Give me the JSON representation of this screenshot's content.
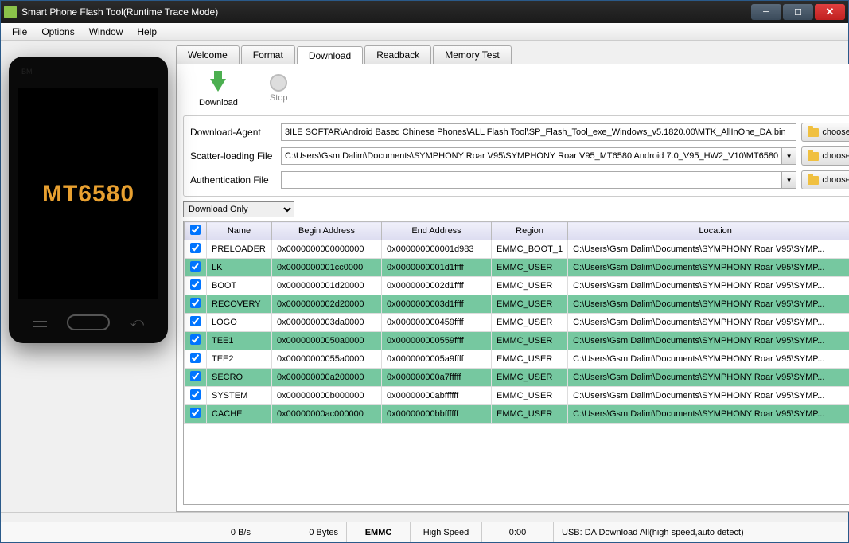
{
  "window": {
    "title": "Smart Phone Flash Tool(Runtime Trace Mode)"
  },
  "menu": [
    "File",
    "Options",
    "Window",
    "Help"
  ],
  "phone": {
    "chip": "MT6580",
    "badge": "BM"
  },
  "tabs": [
    "Welcome",
    "Format",
    "Download",
    "Readback",
    "Memory Test"
  ],
  "activeTab": "Download",
  "toolbar": {
    "download": "Download",
    "stop": "Stop"
  },
  "files": {
    "da_label": "Download-Agent",
    "da_value": "3ILE SOFTAR\\Android Based Chinese Phones\\ALL Flash Tool\\SP_Flash_Tool_exe_Windows_v5.1820.00\\MTK_AllInOne_DA.bin",
    "scatter_label": "Scatter-loading File",
    "scatter_value": "C:\\Users\\Gsm Dalim\\Documents\\SYMPHONY Roar V95\\SYMPHONY Roar V95_MT6580 Android 7.0_V95_HW2_V10\\MT6580",
    "auth_label": "Authentication File",
    "auth_value": "",
    "choose": "choose"
  },
  "mode": "Download Only",
  "table": {
    "headers": {
      "chk": "",
      "name": "Name",
      "begin": "Begin Address",
      "end": "End Address",
      "region": "Region",
      "location": "Location"
    },
    "rows": [
      {
        "alt": false,
        "name": "PRELOADER",
        "begin": "0x0000000000000000",
        "end": "0x000000000001d983",
        "region": "EMMC_BOOT_1",
        "location": "C:\\Users\\Gsm Dalim\\Documents\\SYMPHONY Roar V95\\SYMP..."
      },
      {
        "alt": true,
        "name": "LK",
        "begin": "0x0000000001cc0000",
        "end": "0x0000000001d1ffff",
        "region": "EMMC_USER",
        "location": "C:\\Users\\Gsm Dalim\\Documents\\SYMPHONY Roar V95\\SYMP..."
      },
      {
        "alt": false,
        "name": "BOOT",
        "begin": "0x0000000001d20000",
        "end": "0x0000000002d1ffff",
        "region": "EMMC_USER",
        "location": "C:\\Users\\Gsm Dalim\\Documents\\SYMPHONY Roar V95\\SYMP..."
      },
      {
        "alt": true,
        "name": "RECOVERY",
        "begin": "0x0000000002d20000",
        "end": "0x0000000003d1ffff",
        "region": "EMMC_USER",
        "location": "C:\\Users\\Gsm Dalim\\Documents\\SYMPHONY Roar V95\\SYMP..."
      },
      {
        "alt": false,
        "name": "LOGO",
        "begin": "0x0000000003da0000",
        "end": "0x000000000459ffff",
        "region": "EMMC_USER",
        "location": "C:\\Users\\Gsm Dalim\\Documents\\SYMPHONY Roar V95\\SYMP..."
      },
      {
        "alt": true,
        "name": "TEE1",
        "begin": "0x00000000050a0000",
        "end": "0x000000000559ffff",
        "region": "EMMC_USER",
        "location": "C:\\Users\\Gsm Dalim\\Documents\\SYMPHONY Roar V95\\SYMP..."
      },
      {
        "alt": false,
        "name": "TEE2",
        "begin": "0x00000000055a0000",
        "end": "0x0000000005a9ffff",
        "region": "EMMC_USER",
        "location": "C:\\Users\\Gsm Dalim\\Documents\\SYMPHONY Roar V95\\SYMP..."
      },
      {
        "alt": true,
        "name": "SECRO",
        "begin": "0x000000000a200000",
        "end": "0x000000000a7fffff",
        "region": "EMMC_USER",
        "location": "C:\\Users\\Gsm Dalim\\Documents\\SYMPHONY Roar V95\\SYMP..."
      },
      {
        "alt": false,
        "name": "SYSTEM",
        "begin": "0x000000000b000000",
        "end": "0x00000000abffffff",
        "region": "EMMC_USER",
        "location": "C:\\Users\\Gsm Dalim\\Documents\\SYMPHONY Roar V95\\SYMP..."
      },
      {
        "alt": true,
        "name": "CACHE",
        "begin": "0x00000000ac000000",
        "end": "0x00000000bbffffff",
        "region": "EMMC_USER",
        "location": "C:\\Users\\Gsm Dalim\\Documents\\SYMPHONY Roar V95\\SYMP..."
      }
    ]
  },
  "status": {
    "rate": "0 B/s",
    "bytes": "0 Bytes",
    "storage": "EMMC",
    "speed": "High Speed",
    "time": "0:00",
    "mode": "USB: DA Download All(high speed,auto detect)"
  }
}
